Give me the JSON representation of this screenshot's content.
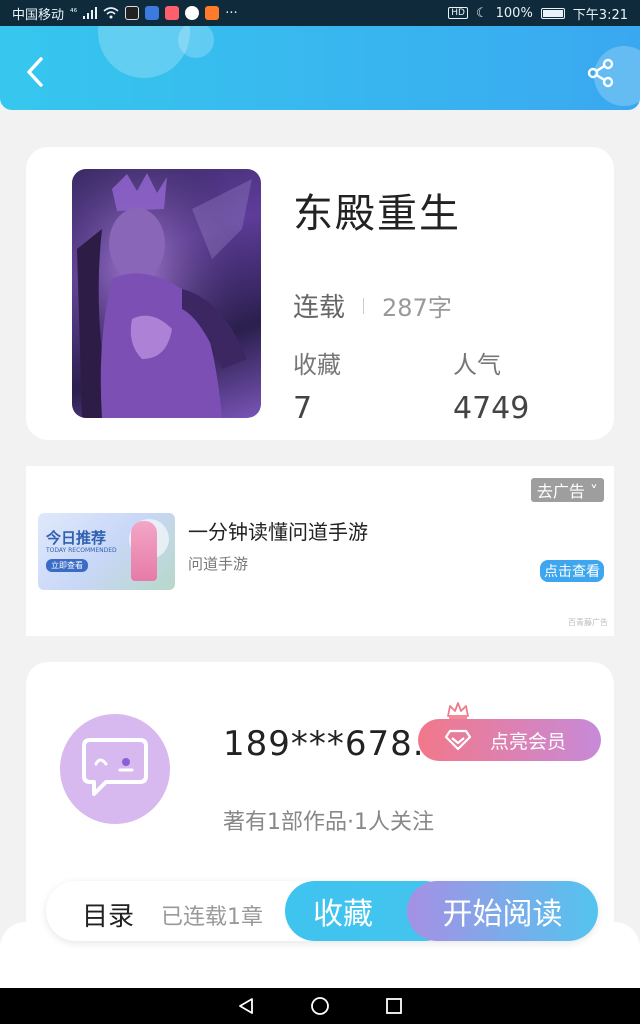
{
  "status_bar": {
    "carrier": "中国移动",
    "signal_label": "⁴⁶",
    "more": "···",
    "hd": "HD",
    "battery": "100%",
    "time": "下午3:21"
  },
  "header": {
    "back_icon": "chevron-left-icon",
    "share_icon": "share-icon",
    "colors": {
      "start": "#36c7ee",
      "end": "#3aa8f0"
    }
  },
  "book": {
    "title": "东殿重生",
    "status": "连载",
    "word_count": "287字",
    "favorites_label": "收藏",
    "favorites_value": "7",
    "popularity_label": "人气",
    "popularity_value": "4749"
  },
  "ad": {
    "remove_label": "去广告 ˅",
    "image_title": "今日推荐",
    "image_subtitle": "TODAY RECOMMENDED",
    "image_button": "立即查看",
    "title": "一分钟读懂问道手游",
    "source": "问道手游",
    "action_label": "点击查看",
    "provider": "百青藤广告"
  },
  "author": {
    "avatar_icon": "chat-bubble-icon",
    "name": "189***678..",
    "stats": "著有1部作品·1人关注",
    "vip_label": "点亮会员",
    "vip_icon": "diamond-icon",
    "crown_icon": "crown-icon"
  },
  "action_bar": {
    "toc_label": "目录",
    "chapter_info": "已连载1章",
    "collect_label": "收藏",
    "read_label": "开始阅读"
  },
  "nav": {
    "back": "triangle-back-icon",
    "home": "circle-home-icon",
    "recents": "square-recents-icon"
  }
}
